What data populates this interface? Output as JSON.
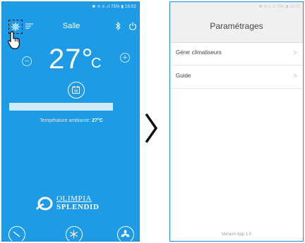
{
  "left_screen": {
    "status_bar": "✱ ✕ ≡ .ıl 75% ▮ 16:02",
    "room_name": "Salle",
    "temperature_value": "27°",
    "temperature_unit": "C",
    "minus_label": "−",
    "plus_label": "+",
    "schedule_icon_letter": "M",
    "ambient_label": "Température ambiante:",
    "ambient_value": "27°C",
    "logo_line1": "OLIMPIA",
    "logo_line2": "SPLENDID",
    "colors": {
      "background": "#1e9be6",
      "foreground": "#ffffff"
    }
  },
  "arrow_icon": "chevron-right-icon",
  "right_screen": {
    "status_bar": "✱ ✕ ≡ .ıl 75% ▮ 16:02",
    "title": "Paramétrages",
    "menu_items": [
      {
        "label": "Gérer climatiseurs"
      },
      {
        "label": "Guide"
      }
    ],
    "version_text": "Version App 1.0",
    "colors": {
      "header": "#f0f0f0",
      "text": "#444444"
    }
  }
}
